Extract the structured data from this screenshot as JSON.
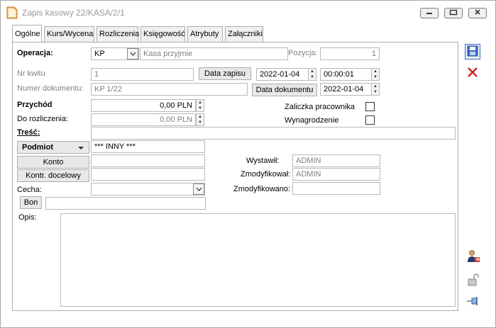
{
  "window": {
    "title": "Zapis kasowy 22/KASA/2/1",
    "controls": {
      "minimize": "▭",
      "restore": "▣",
      "close": "✕"
    }
  },
  "tabs": [
    {
      "label": "Ogólne",
      "active": true
    },
    {
      "label": "Kurs/Wycena"
    },
    {
      "label": "Rozliczenia"
    },
    {
      "label": "Księgowość"
    },
    {
      "label": "Atrybuty"
    },
    {
      "label": "Załączniki"
    }
  ],
  "form": {
    "operacja_label": "Operacja:",
    "operacja_code": "KP",
    "operacja_name": "Kasa przyjmie",
    "pozycja_label": "Pozycja:",
    "pozycja_value": "1",
    "nr_kwitu_label": "Nr kwitu",
    "nr_kwitu_value": "1",
    "data_zapisu_button": "Data zapisu",
    "data_zapisu_date": "2022-01-04",
    "data_zapisu_time": "00:00:01",
    "numer_dokumentu_label": "Numer dokumentu:",
    "numer_dokumentu_value": "KP 1/22",
    "data_dokumentu_button": "Data dokumentu",
    "data_dokumentu_value": "2022-01-04",
    "przychod_label": "Przychód",
    "przychod_value": "0,00 PLN",
    "do_rozliczenia_label": "Do rozliczenia:",
    "do_rozliczenia_value": "0,00 PLN",
    "zaliczka_label": "Zaliczka pracownika",
    "wynagrodzenie_label": "Wynagrodzenie",
    "tresc_label": "Treść:",
    "tresc_value": "",
    "podmiot_button": "Podmiot",
    "podmiot_value": "*** INNY ***",
    "konto_button": "Konto",
    "konto_value": "",
    "kontr_docelowy_button": "Kontr. docelowy",
    "kontr_docelowy_value": "",
    "cecha_label": "Cecha:",
    "cecha_value": "",
    "bon_button": "Bon",
    "bon_value": "",
    "wystawil_label": "Wystawił:",
    "wystawil_value": "ADMIN",
    "zmodyfikowal_label": "Zmodyfikował:",
    "zmodyfikowal_value": "ADMIN",
    "zmodyfikowano_label": "Zmodyfikowano:",
    "zmodyfikowano_value": "",
    "opis_label": "Opis:",
    "opis_value": ""
  },
  "icons": {
    "save": "save-icon",
    "delete": "delete-icon",
    "person_transfer": "person-transfer-icon",
    "lock": "lock-icon",
    "pin": "pin-icon"
  },
  "colors": {
    "accent_blue": "#3a6fbf",
    "delete_red": "#d22020",
    "label_gray": "#808080"
  }
}
